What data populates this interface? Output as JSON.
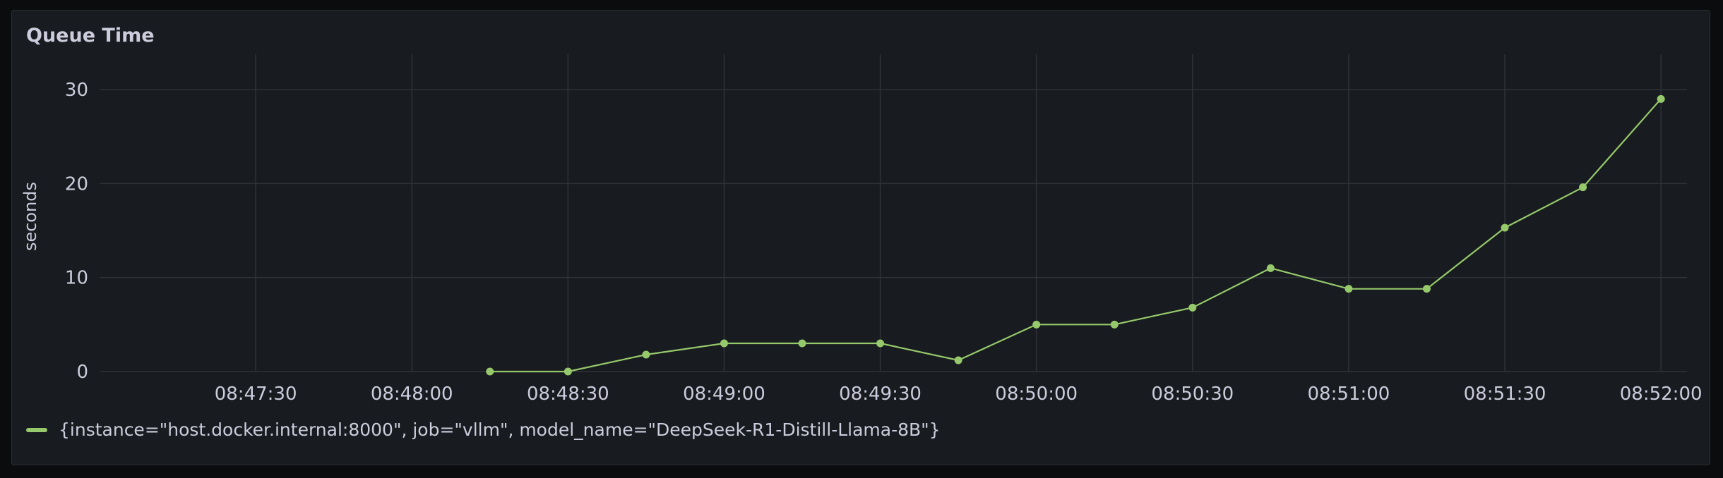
{
  "panel": {
    "title": "Queue Time"
  },
  "colors": {
    "series": "#96c96b",
    "grid": "#2f3237",
    "text": "#ccccdc"
  },
  "chart_data": {
    "type": "line",
    "title": "Queue Time",
    "xlabel": "",
    "ylabel": "seconds",
    "ylim": [
      0,
      33
    ],
    "y_ticks": [
      0,
      10,
      20,
      30
    ],
    "x_ticks": [
      "08:47:30",
      "08:48:00",
      "08:48:30",
      "08:49:00",
      "08:49:30",
      "08:50:00",
      "08:50:30",
      "08:51:00",
      "08:51:30",
      "08:52:00"
    ],
    "xlim": [
      "08:47:00",
      "08:52:05"
    ],
    "grid": true,
    "legend_position": "bottom-left",
    "series": [
      {
        "name": "{instance=\"host.docker.internal:8000\", job=\"vllm\", model_name=\"DeepSeek-R1-Distill-Llama-8B\"}",
        "x": [
          "08:48:15",
          "08:48:30",
          "08:48:45",
          "08:49:00",
          "08:49:15",
          "08:49:30",
          "08:49:45",
          "08:50:00",
          "08:50:15",
          "08:50:30",
          "08:50:45",
          "08:51:00",
          "08:51:15",
          "08:51:30",
          "08:51:45",
          "08:52:00"
        ],
        "y": [
          0,
          0,
          1.8,
          3,
          3,
          3,
          1.2,
          5,
          5,
          6.8,
          11,
          8.8,
          8.8,
          15.3,
          19.6,
          29
        ]
      }
    ]
  }
}
